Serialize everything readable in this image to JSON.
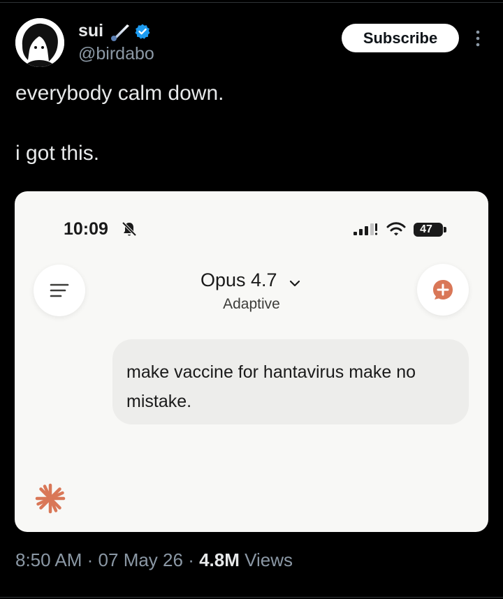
{
  "tweet": {
    "author": {
      "display_name": "sui",
      "handle": "@birdabo",
      "avatar_icon": "anime-avatar",
      "name_emoji_icon": "comet-icon",
      "verified_icon": "verified-badge",
      "verified_color": "#1d9bf0"
    },
    "subscribe_label": "Subscribe",
    "text_lines": [
      "everybody calm down.",
      "i got this."
    ],
    "meta": {
      "time": "8:50 AM",
      "separator": "·",
      "date": "07 May 26",
      "views_count": "4.8M",
      "views_label": "Views"
    }
  },
  "screenshot": {
    "status_bar": {
      "time": "10:09",
      "battery": "47"
    },
    "header": {
      "model": "Opus 4.7",
      "mode": "Adaptive"
    },
    "message": "make vaccine for hantavirus make no mistake.",
    "colors": {
      "accent": "#d97757",
      "background": "#f8f8f6",
      "bubble": "#ededeb"
    }
  }
}
